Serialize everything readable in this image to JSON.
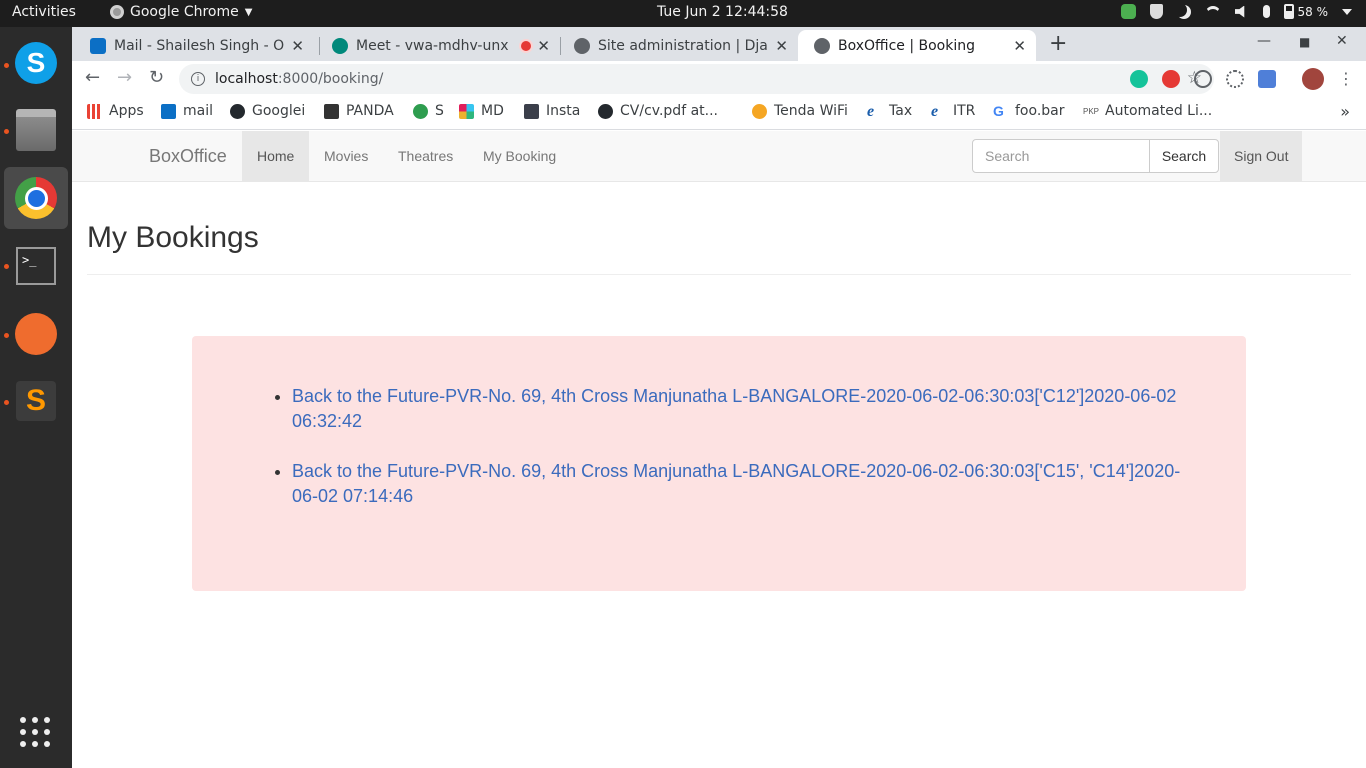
{
  "system": {
    "activities": "Activities",
    "app_name": "Google Chrome",
    "clock": "Tue Jun 2  12:44:58",
    "battery": "58 %"
  },
  "tabs": [
    {
      "title": "Mail - Shailesh Singh - Out",
      "color": "#0b6fc5"
    },
    {
      "title": "Meet - vwa-mdhv-unx",
      "color": "#00897b"
    },
    {
      "title": "Site administration | Djan",
      "color": "#5f6368"
    },
    {
      "title": "BoxOffice | Booking",
      "color": "#5f6368"
    }
  ],
  "address": {
    "host": "localhost",
    "path": ":8000/booking/"
  },
  "bookmarks": [
    {
      "label": "Apps",
      "color": "#ea4335"
    },
    {
      "label": "mail",
      "color": "#0b6fc5"
    },
    {
      "label": "Googlei",
      "color": "#24292e"
    },
    {
      "label": "PANDA",
      "color": "#333333"
    },
    {
      "label": "S",
      "color": "#2e9d4f"
    },
    {
      "label": "MD",
      "color": "#e01e5a"
    },
    {
      "label": "Insta",
      "color": "#3b3f4a"
    },
    {
      "label": "CV/cv.pdf at...",
      "color": "#24292e"
    },
    {
      "label": "Tenda WiFi",
      "color": "#f5a623"
    },
    {
      "label": "Tax",
      "color": "#1a5dab"
    },
    {
      "label": "ITR",
      "color": "#1a5dab"
    },
    {
      "label": "foo.bar",
      "color": "#4285f4"
    },
    {
      "label": "Automated Li...",
      "color": "#555555"
    }
  ],
  "site": {
    "brand": "BoxOffice",
    "nav": [
      "Home",
      "Movies",
      "Theatres",
      "My Booking"
    ],
    "search_placeholder": "Search",
    "search_button": "Search",
    "sign_out": "Sign Out"
  },
  "page": {
    "heading": "My Bookings",
    "bookings": [
      "Back to the Future-PVR-No. 69, 4th Cross Manjunatha L-BANGALORE-2020-06-02-06:30:03['C12']2020-06-02 06:32:42",
      "Back to the Future-PVR-No. 69, 4th Cross Manjunatha L-BANGALORE-2020-06-02-06:30:03['C15', 'C14']2020-06-02 07:14:46"
    ]
  }
}
